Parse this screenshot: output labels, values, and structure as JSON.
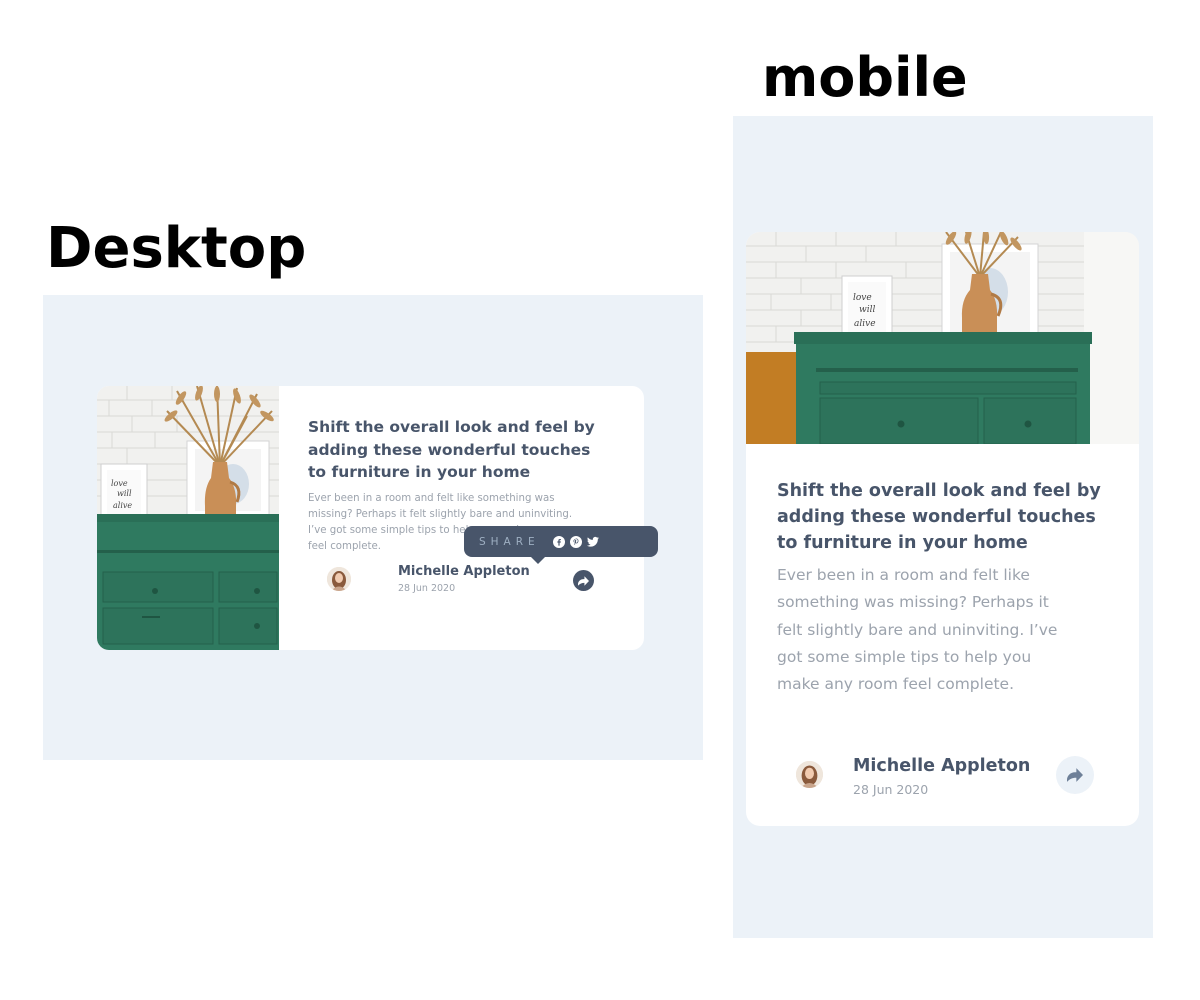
{
  "labels": {
    "desktop": "Desktop",
    "mobile": "mobile"
  },
  "card": {
    "title": "Shift the overall look and feel by adding these wonderful touches to furniture in your home",
    "excerpt_desktop": "Ever been in a room and felt like something was missing? Perhaps it felt slightly bare and uninviting. I’ve got some simple tips to help you make any room feel complete.",
    "excerpt_mobile": "Ever been in a room and felt like something was missing? Perhaps it felt slightly bare and uninviting. I’ve got some simple tips to help you make any room feel complete.",
    "author": {
      "name": "Michelle Appleton",
      "date": "28 Jun 2020"
    }
  },
  "share": {
    "label": "SHARE",
    "networks": [
      "facebook-icon",
      "pinterest-icon",
      "twitter-icon"
    ],
    "button_icon": "share-arrow-icon"
  },
  "colors": {
    "background": "#ecf2f8",
    "heading": "#48556a",
    "body_text": "#9ca3ad",
    "tooltip": "#48556a",
    "tooltip_label": "#9eafc2",
    "drawer_green": "#2f7a60",
    "vase": "#c98f57"
  }
}
